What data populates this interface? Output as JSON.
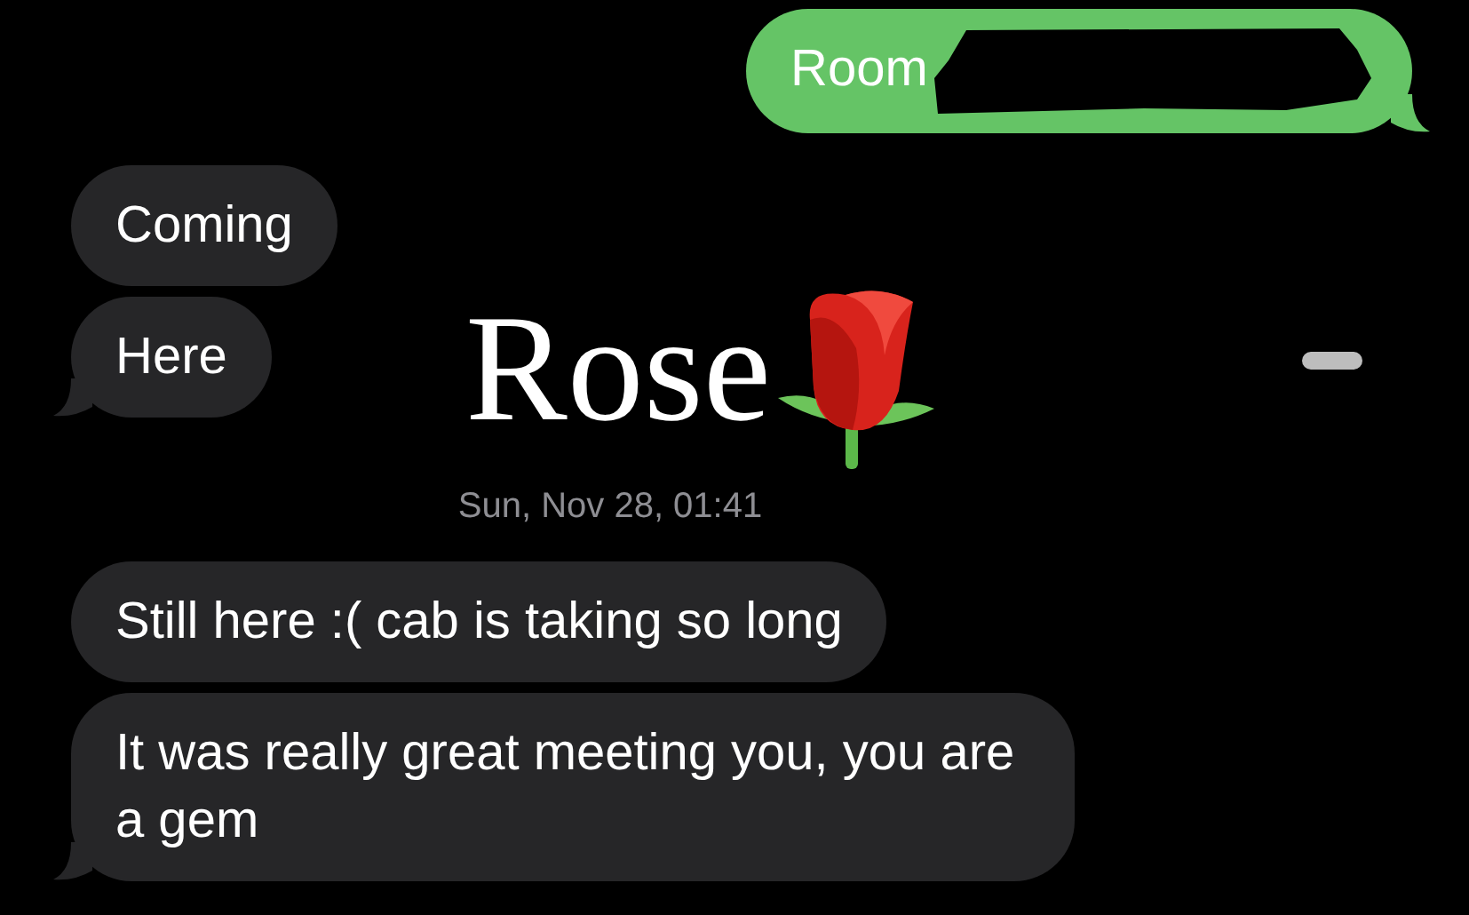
{
  "thread": [
    {
      "kind": "sent",
      "text": "Room",
      "redacted": true,
      "tail": true
    },
    {
      "kind": "received",
      "text": "Coming",
      "tail": false
    },
    {
      "kind": "received",
      "text": "Here",
      "tail": true
    },
    {
      "kind": "timestamp",
      "text": "Sun, Nov 28, 01:41"
    },
    {
      "kind": "received",
      "text": "Still here :( cab is taking so long",
      "tail": false
    },
    {
      "kind": "received",
      "text": "It was really great meeting you, you are a gem",
      "tail": true
    }
  ],
  "sticker": {
    "text": "Rose"
  }
}
